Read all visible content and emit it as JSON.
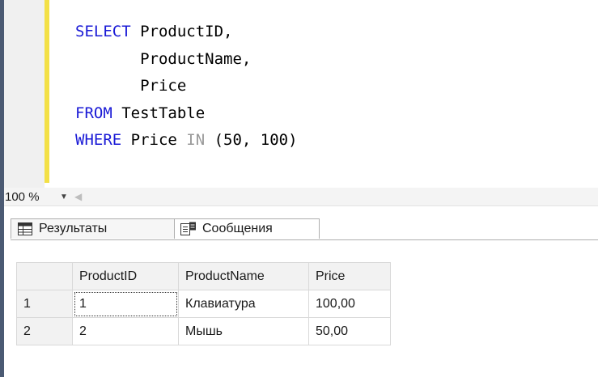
{
  "editor": {
    "lines": [
      {
        "kw": "SELECT",
        "rest": " ProductID,"
      },
      {
        "kw": "",
        "rest": "       ProductName,"
      },
      {
        "kw": "",
        "rest": "       Price"
      },
      {
        "kw": "FROM",
        "rest": " TestTable"
      },
      {
        "kw": "WHERE",
        "rest": " Price ",
        "op": "IN",
        "tail": " (50, 100)"
      }
    ]
  },
  "statusbar": {
    "zoom": "100 %",
    "zoom_arrow": "▼",
    "scroll_left_arrow": "◀"
  },
  "tabs": {
    "results_label": "Результаты",
    "messages_label": "Сообщения"
  },
  "results": {
    "columns": [
      "ProductID",
      "ProductName",
      "Price"
    ],
    "rows": [
      {
        "num": "1",
        "ProductID": "1",
        "ProductName": "Клавиатура",
        "Price": "100,00"
      },
      {
        "num": "2",
        "ProductID": "2",
        "ProductName": "Мышь",
        "Price": "50,00"
      }
    ]
  },
  "colors": {
    "keyword": "#1a1ad6",
    "operator": "#9a9a9a",
    "change_bar": "#f3e046"
  }
}
